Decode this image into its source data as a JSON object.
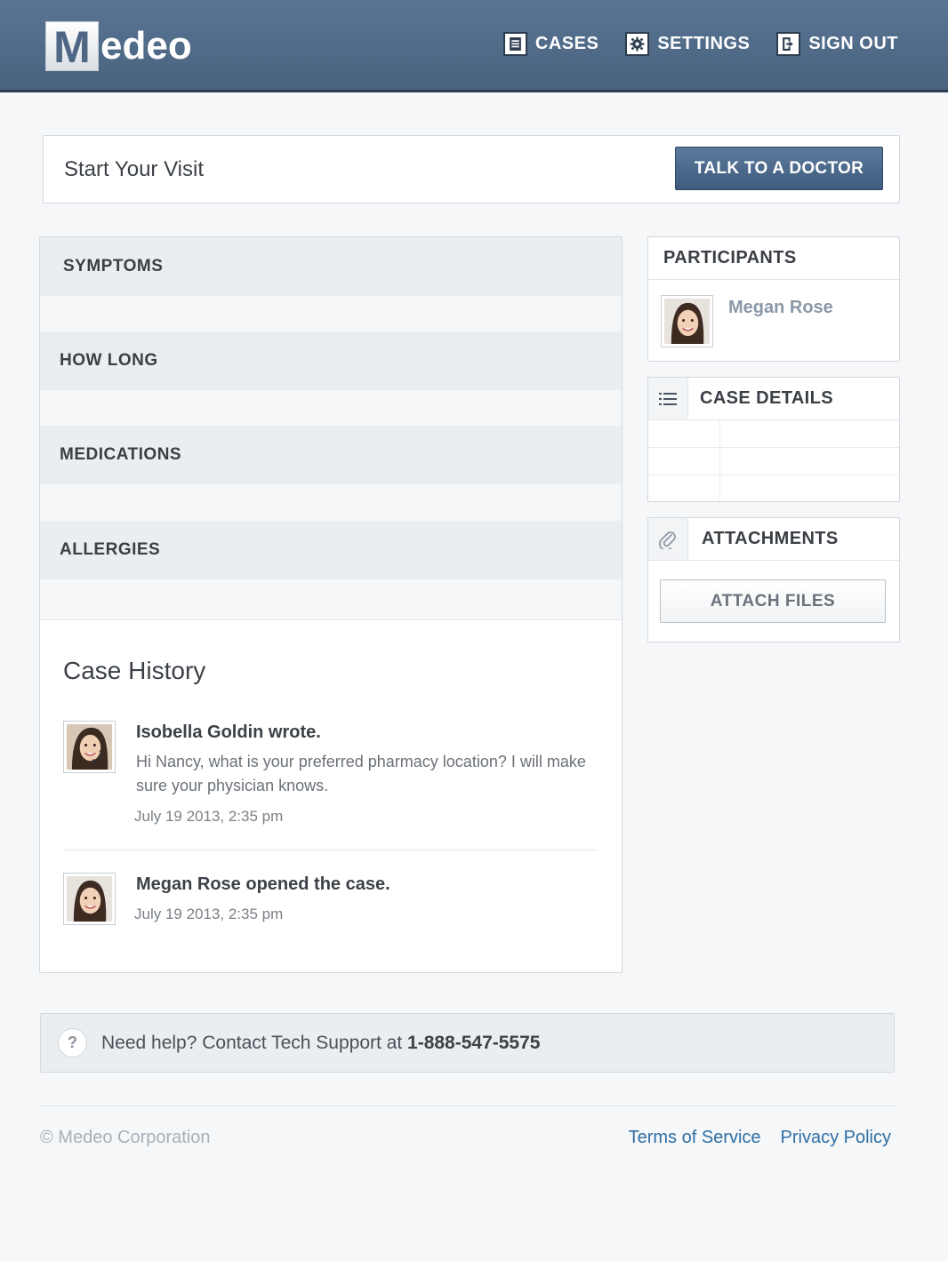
{
  "header": {
    "logo_letter": "M",
    "logo_rest": "edeo",
    "nav": [
      {
        "label": "CASES",
        "icon": "cases-icon"
      },
      {
        "label": "SETTINGS",
        "icon": "gear-icon"
      },
      {
        "label": "SIGN OUT",
        "icon": "sign-out-icon"
      }
    ]
  },
  "visit": {
    "title": "Start Your Visit",
    "button": "TALK TO A DOCTOR"
  },
  "form": {
    "fields": [
      "SYMPTOMS",
      "HOW LONG",
      "MEDICATIONS",
      "ALLERGIES"
    ]
  },
  "history": {
    "title": "Case History",
    "entries": [
      {
        "title": "Isobella Goldin wrote.",
        "text": "Hi Nancy, what is your preferred pharmacy location? I will make sure your physician knows.",
        "time": "July 19 2013, 2:35 pm"
      },
      {
        "title": "Megan Rose opened the case.",
        "time": "July 19 2013, 2:35 pm"
      }
    ]
  },
  "participants": {
    "title": "PARTICIPANTS",
    "items": [
      {
        "name": "Megan Rose"
      }
    ]
  },
  "case_details": {
    "title": "CASE DETAILS",
    "icon": "list-icon"
  },
  "attachments": {
    "title": "ATTACHMENTS",
    "icon": "paperclip-icon",
    "button": "ATTACH FILES"
  },
  "help": {
    "text": "Need help? Contact Tech Support at ",
    "phone": "1-888-547-5575",
    "icon": "question-icon"
  },
  "footer": {
    "copyright": "© Medeo Corporation",
    "links": [
      "Terms of Service",
      "Privacy Policy"
    ]
  },
  "colors": {
    "header": "#4f6a89",
    "primary_button": "#46638a",
    "link": "#2f6da3"
  }
}
